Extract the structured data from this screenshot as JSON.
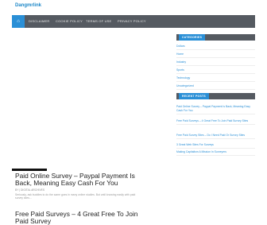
{
  "site": {
    "logo": "Dangmrlink"
  },
  "nav": {
    "home_icon": "home-icon",
    "items": [
      "DISCLAIMER",
      "COOKIE POLICY",
      "TERMS OF USE",
      "PRIVACY POLICY"
    ]
  },
  "posts": [
    {
      "title": "Paid Online Survey – Paypal Payment Is Back, Meaning Easy Cash For You",
      "meta": "BY | DIGITAL ARCHIVES",
      "excerpt": "Seriously, ask buddies to do the same goes in many online studies. But until knowing easily with paid survey sites..."
    },
    {
      "title": "Free Paid Surveys – 4 Great Free To Join Paid Survey"
    }
  ],
  "sidebar": {
    "categories_title": "CATEGORIES",
    "categories": [
      "Dollars",
      "Home",
      "Industry",
      "Sports",
      "Technology",
      "Uncategorized"
    ],
    "recent_title": "RECENT POSTS",
    "recent": [
      "Paid Online Survey – Paypal Payment Is Back, Meaning Easy Cash For You",
      "Free Paid Surveys – 4 Great Free To Join Paid Survey Sites",
      "Free Paid Survey Sites – Do I Need Paid Or Survey Sites",
      "3 Great Web Sites For Surveys",
      "Making Capitalism A Mission In Surveyers"
    ]
  }
}
